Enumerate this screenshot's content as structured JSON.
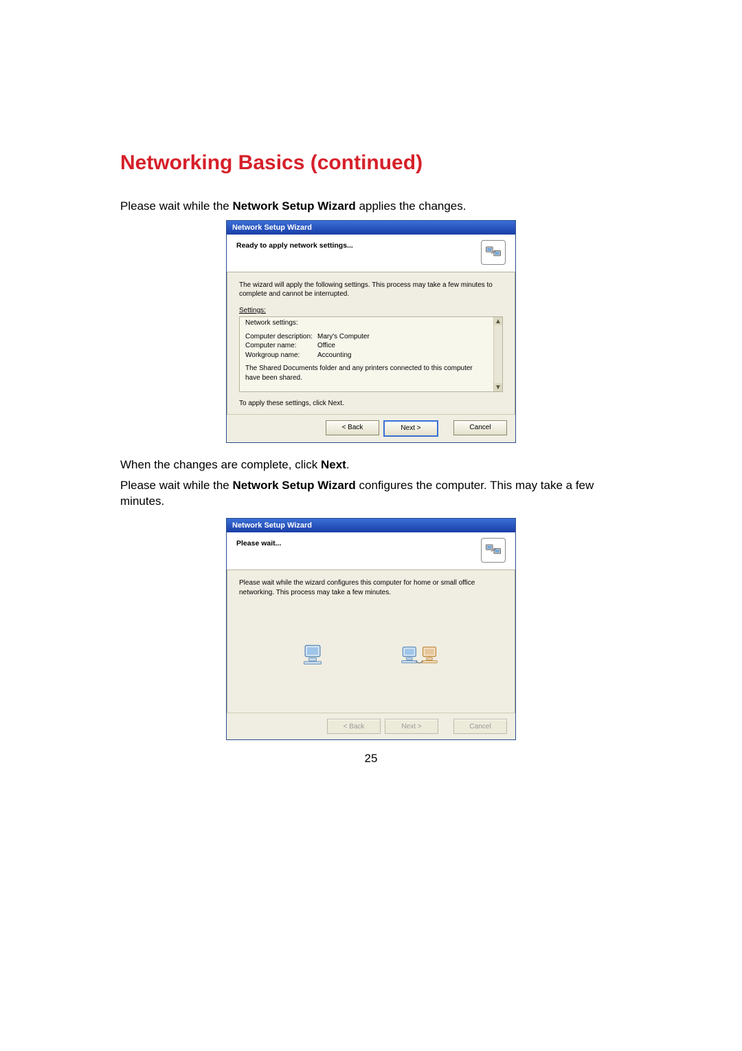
{
  "page": {
    "title": "Networking Basics (continued)",
    "number": "25"
  },
  "text": {
    "intro1a": "Please wait while the ",
    "intro1b": "Network Setup Wizard",
    "intro1c": " applies the changes.",
    "mid1a": "When the changes are complete, click ",
    "mid1b": "Next",
    "mid1c": ".",
    "intro2a": "Please wait while the ",
    "intro2b": "Network Setup Wizard",
    "intro2c": " configures the computer. This may take a few minutes."
  },
  "wizard1": {
    "title": "Network Setup Wizard",
    "header": "Ready to apply network settings...",
    "body1": "The wizard will apply the following settings. This process may take a few minutes to complete and cannot be interrupted.",
    "settings_label": "Settings:",
    "network_settings": "Network settings:",
    "rows": [
      {
        "key": "Computer description:",
        "val": "Mary's Computer"
      },
      {
        "key": "Computer name:",
        "val": "Office"
      },
      {
        "key": "Workgroup name:",
        "val": "Accounting"
      }
    ],
    "shared": "The Shared Documents folder and any printers connected to this computer have been shared.",
    "apply": "To apply these settings, click Next.",
    "buttons": {
      "back": "< Back",
      "next": "Next >",
      "cancel": "Cancel"
    }
  },
  "wizard2": {
    "title": "Network Setup Wizard",
    "header": "Please wait...",
    "body1": "Please wait while the wizard configures this computer for home or small office networking. This process may take a few minutes.",
    "buttons": {
      "back": "< Back",
      "next": "Next >",
      "cancel": "Cancel"
    }
  },
  "icons": {
    "wizard_header_icon": "network-devices-icon",
    "wait_icon_single": "computer-icon",
    "wait_icon_pair": "computer-pair-icon"
  }
}
